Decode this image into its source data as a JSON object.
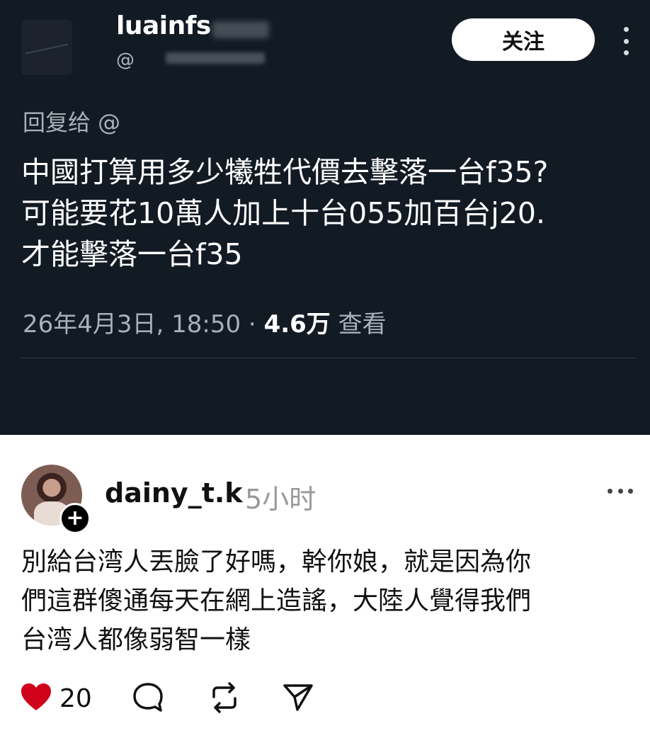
{
  "post": {
    "username": "luainfs",
    "handle_prefix": "@",
    "follow_label": "关注",
    "reply_to": "回复给 @",
    "text": "中國打算用多少犧牲代價去擊落一台f35?\n可能要花10萬人加上十台055加百台j20.\n才能擊落一台f35",
    "timestamp": "26年4月3日, 18:50",
    "separator": " · ",
    "views": "4.6万",
    "views_label": " 查看"
  },
  "reply": {
    "username": "dainy_t.k",
    "time": "5小时",
    "add_icon": "+",
    "text": "別給台湾人丟臉了好嗎，幹你娘，就是因為你\n們這群傻通每天在網上造謠，大陸人覺得我們\n台湾人都像弱智一樣",
    "like_count": "20"
  },
  "colors": {
    "dark_bg": "#121a24",
    "like_red": "#d0021b"
  },
  "icons": [
    "more-vertical-icon",
    "heart-icon",
    "comment-icon",
    "repost-icon",
    "share-icon",
    "more-horizontal-icon",
    "add-follow-icon"
  ]
}
